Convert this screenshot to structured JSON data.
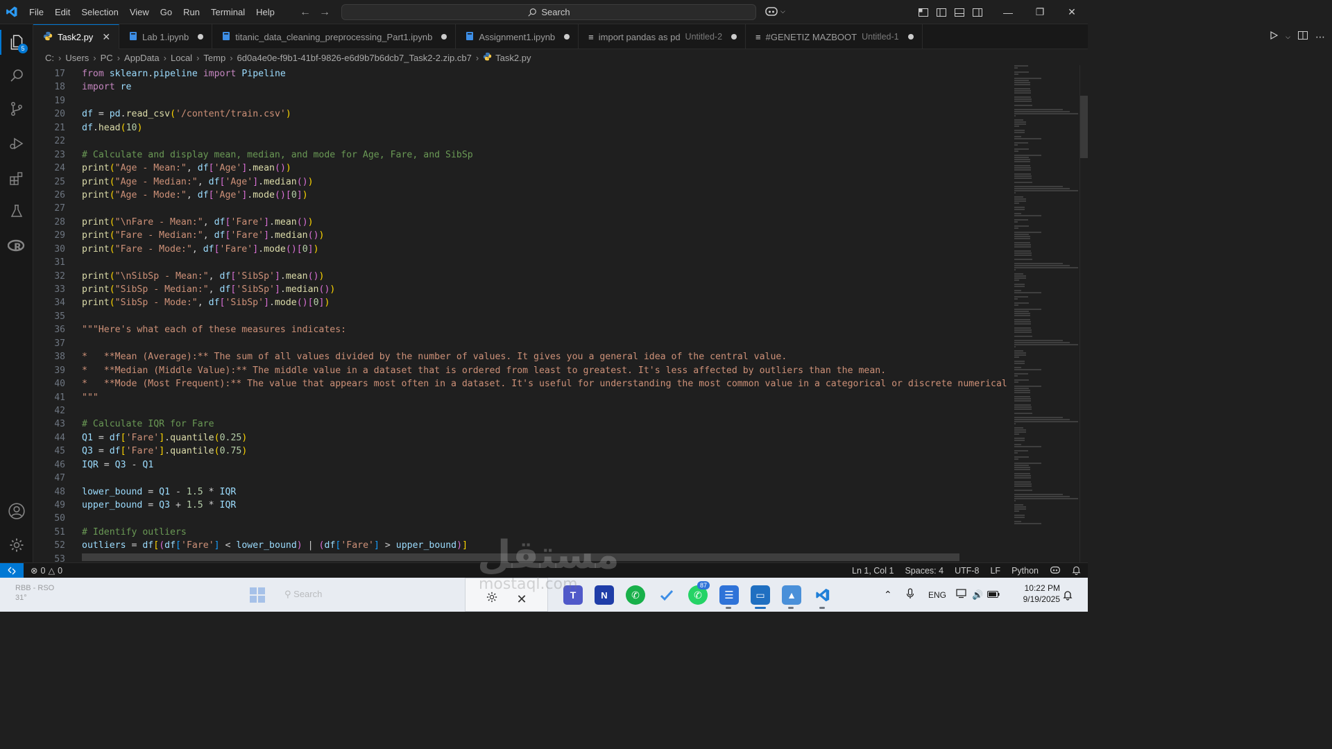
{
  "titlebar": {
    "menu": [
      "File",
      "Edit",
      "Selection",
      "View",
      "Go",
      "Run",
      "Terminal",
      "Help"
    ],
    "search_label": "Search"
  },
  "activity": {
    "explorer_badge": "5"
  },
  "tabs": [
    {
      "label": "Task2.py",
      "sub": "",
      "icon": "python-file-icon",
      "active": true
    },
    {
      "label": "Lab 1.ipynb",
      "sub": "",
      "icon": "notebook-file-icon",
      "active": false
    },
    {
      "label": "titanic_data_cleaning_preprocessing_Part1.ipynb",
      "sub": "",
      "icon": "notebook-file-icon",
      "active": false
    },
    {
      "label": "Assignment1.ipynb",
      "sub": "",
      "icon": "notebook-file-icon",
      "active": false
    },
    {
      "label": "import pandas as pd",
      "sub": "Untitled-2",
      "icon": "text-file-icon",
      "active": false
    },
    {
      "label": "#GENETIZ MAZBOOT",
      "sub": "Untitled-1",
      "icon": "text-file-icon",
      "active": false
    }
  ],
  "breadcrumb": [
    "C:",
    "Users",
    "PC",
    "AppData",
    "Local",
    "Temp",
    "6d0a4e0e-f9b1-41bf-9826-e6d9b7b6dcb7_Task2-2.zip.cb7",
    "Task2.py"
  ],
  "editor": {
    "line_numbers": [
      "17",
      "18",
      "19",
      "20",
      "21",
      "22",
      "23",
      "24",
      "25",
      "26",
      "27",
      "28",
      "29",
      "30",
      "31",
      "32",
      "33",
      "34",
      "35",
      "36",
      "37",
      "38",
      "39",
      "40",
      "41",
      "42",
      "43",
      "44",
      "45",
      "46",
      "47",
      "48",
      "49",
      "50",
      "51",
      "52",
      "53"
    ],
    "lines": [
      "from sklearn.pipeline import Pipeline",
      "import re",
      "",
      "df = pd.read_csv('/content/train.csv')",
      "df.head(10)",
      "",
      "# Calculate and display mean, median, and mode for Age, Fare, and SibSp",
      "print(\"Age - Mean:\", df['Age'].mean())",
      "print(\"Age - Median:\", df['Age'].median())",
      "print(\"Age - Mode:\", df['Age'].mode()[0])",
      "",
      "print(\"\\nFare - Mean:\", df['Fare'].mean())",
      "print(\"Fare - Median:\", df['Fare'].median())",
      "print(\"Fare - Mode:\", df['Fare'].mode()[0])",
      "",
      "print(\"\\nSibSp - Mean:\", df['SibSp'].mean())",
      "print(\"SibSp - Median:\", df['SibSp'].median())",
      "print(\"SibSp - Mode:\", df['SibSp'].mode()[0])",
      "",
      "\"\"\"Here's what each of these measures indicates:",
      "",
      "*   **Mean (Average):** The sum of all values divided by the number of values. It gives you a general idea of the central value.",
      "*   **Median (Middle Value):** The middle value in a dataset that is ordered from least to greatest. It's less affected by outliers than the mean.",
      "*   **Mode (Most Frequent):** The value that appears most often in a dataset. It's useful for understanding the most common value in a categorical or discrete numerical c",
      "\"\"\"",
      "",
      "# Calculate IQR for Fare",
      "Q1 = df['Fare'].quantile(0.25)",
      "Q3 = df['Fare'].quantile(0.75)",
      "IQR = Q3 - Q1",
      "",
      "lower_bound = Q1 - 1.5 * IQR",
      "upper_bound = Q3 + 1.5 * IQR",
      "",
      "# Identify outliers",
      "outliers = df[(df['Fare'] < lower_bound) | (df['Fare'] > upper_bound)]",
      ""
    ]
  },
  "statusbar": {
    "errors": "0",
    "warnings": "0",
    "cursor": "Ln 1, Col 1",
    "spaces": "Spaces: 4",
    "encoding": "UTF-8",
    "eol": "LF",
    "language": "Python"
  },
  "taskbar": {
    "weather_line1": "RBB - RSO",
    "weather_line2": "31°",
    "search_placeholder": "Search",
    "whatsapp_badge": "87",
    "language": "ENG",
    "time": "10:22 PM",
    "date": "9/19/2025"
  },
  "watermark": {
    "text": "مستقل",
    "sub": "mostaql.com"
  },
  "colors": {
    "accent": "#0078d4",
    "editor_bg": "#1f1f1f",
    "keyword": "#c586c0",
    "string": "#ce9178",
    "comment": "#6a9955",
    "function": "#dcdcaa",
    "number": "#b5cea8"
  }
}
